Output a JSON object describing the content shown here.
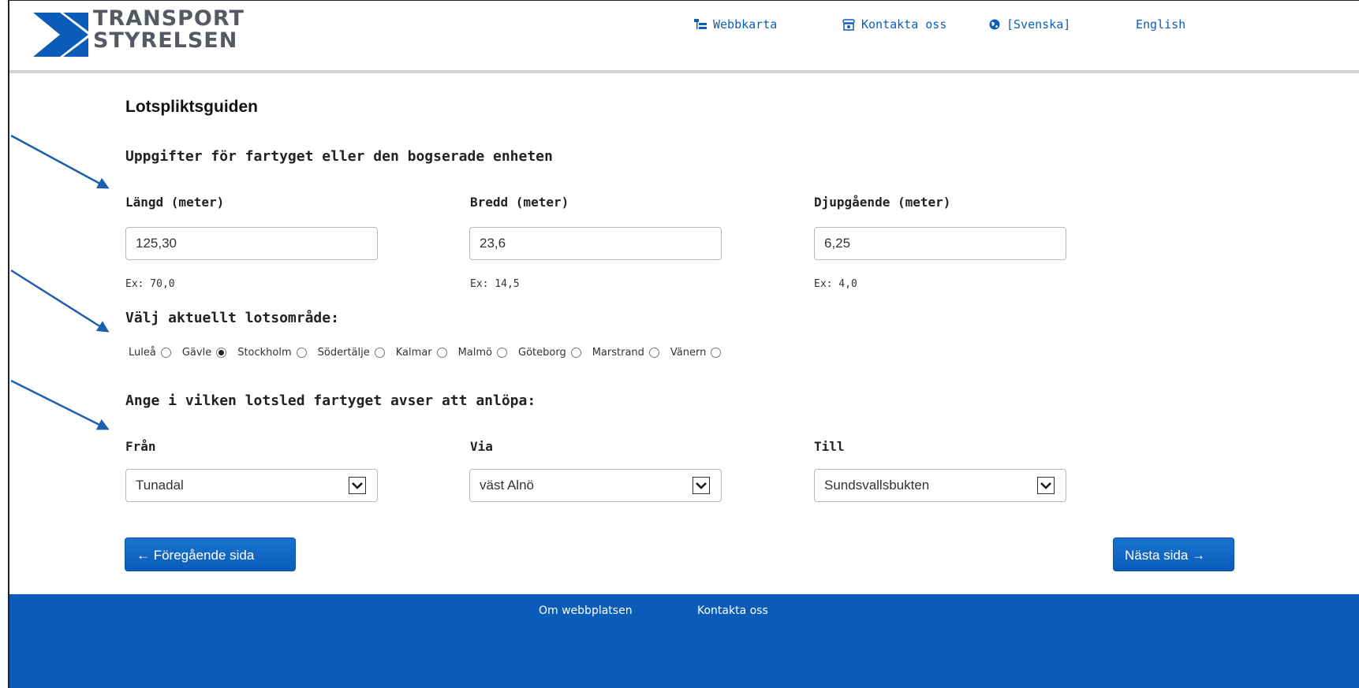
{
  "header": {
    "brand_line1": "TRANSPORT",
    "brand_line2": "STYRELSEN",
    "links": [
      {
        "label": "Webbkarta",
        "icon": "sitemap-icon"
      },
      {
        "label": "Kontakta oss",
        "icon": "phone-icon"
      },
      {
        "label": "[Svenska]",
        "icon": "globe-icon"
      },
      {
        "label": "English"
      }
    ]
  },
  "main": {
    "title": "Lotspliktsguiden",
    "vessel_section": "Uppgifter för fartyget eller den bogserade enheten",
    "fields": [
      {
        "label": "Längd (meter)",
        "value": "125,30",
        "hint": "Ex: 70,0"
      },
      {
        "label": "Bredd (meter)",
        "value": "23,6",
        "hint": "Ex: 14,5"
      },
      {
        "label": "Djupgående (meter)",
        "value": "6,25",
        "hint": "Ex: 4,0"
      }
    ],
    "area_section": "Välj aktuellt lotsområde:",
    "areas": [
      "Luleå",
      "Gävle",
      "Stockholm",
      "Södertälje",
      "Kalmar",
      "Malmö",
      "Göteborg",
      "Marstrand",
      "Vänern"
    ],
    "selected_area": "Gävle",
    "route_section": "Ange i vilken lotsled fartyget avser att anlöpa:",
    "route": [
      {
        "label": "Från",
        "value": "Tunadal"
      },
      {
        "label": "Via",
        "value": "väst Alnö"
      },
      {
        "label": "Till",
        "value": "Sundsvallsbukten"
      }
    ],
    "prev_button": "← Föregående sida",
    "next_button": "Nästa sida →"
  },
  "footer": {
    "links": [
      "Om webbplatsen",
      "Kontakta oss"
    ]
  },
  "colors": {
    "brand_blue": "#0a5cb8",
    "link_blue": "#0d5fb6",
    "logo_blue": "#0a5cb8"
  }
}
